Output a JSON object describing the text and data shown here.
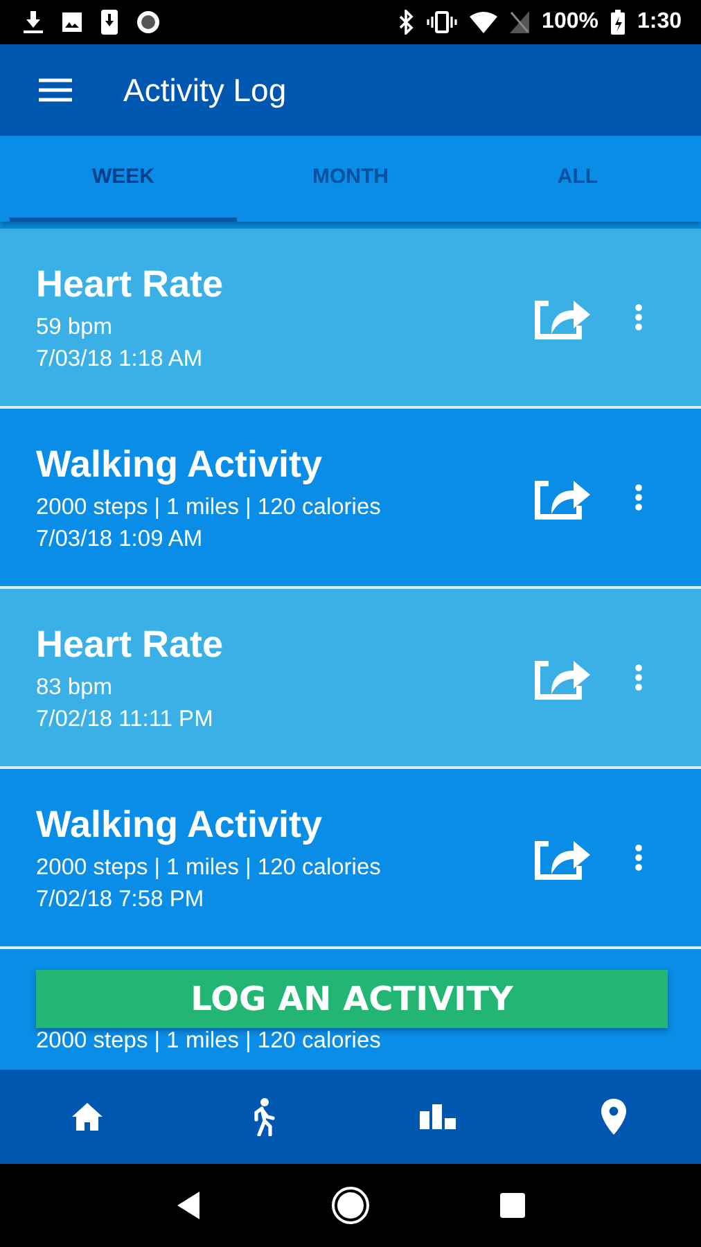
{
  "status_bar": {
    "battery": "100%",
    "time": "1:30"
  },
  "app_bar": {
    "title": "Activity Log"
  },
  "tabs": [
    {
      "label": "WEEK",
      "selected": true
    },
    {
      "label": "MONTH",
      "selected": false
    },
    {
      "label": "ALL",
      "selected": false
    }
  ],
  "entries": [
    {
      "kind": "heart_rate",
      "title": "Heart Rate",
      "detail": "59 bpm",
      "time": "7/03/18 1:18 AM"
    },
    {
      "kind": "walking",
      "title": "Walking Activity",
      "detail": "2000 steps | 1 miles | 120 calories",
      "time": "7/03/18 1:09 AM"
    },
    {
      "kind": "heart_rate",
      "title": "Heart Rate",
      "detail": "83 bpm",
      "time": "7/02/18 11:11 PM"
    },
    {
      "kind": "walking",
      "title": "Walking Activity",
      "detail": "2000 steps | 1 miles | 120 calories",
      "time": "7/02/18 7:58 PM"
    },
    {
      "kind": "walking",
      "detail": "2000 steps | 1 miles | 120 calories"
    }
  ],
  "log_button": "LOG AN ACTIVITY",
  "bottom_nav": [
    {
      "kind": "home"
    },
    {
      "kind": "walk"
    },
    {
      "kind": "stats"
    },
    {
      "kind": "location"
    }
  ]
}
